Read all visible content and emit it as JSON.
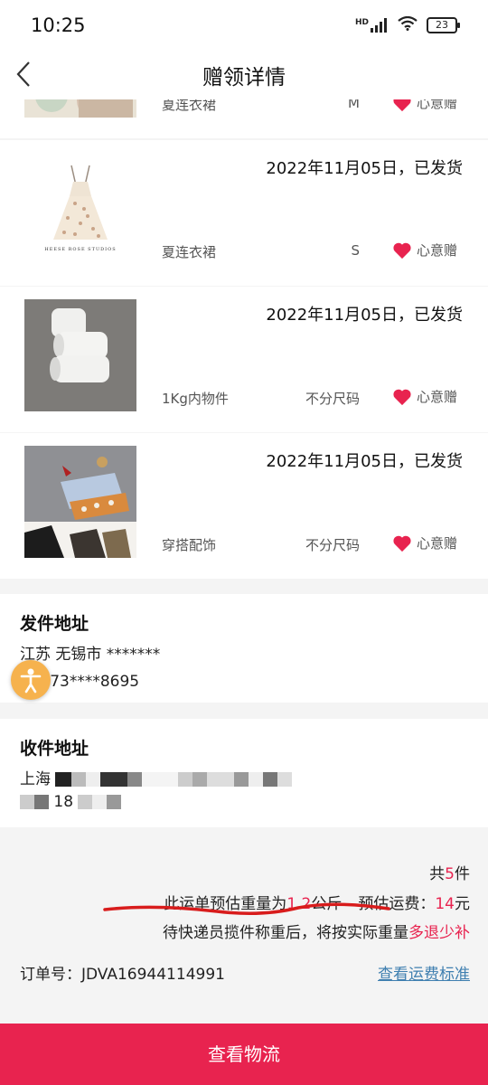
{
  "status_bar": {
    "time": "10:25",
    "network": "HD",
    "battery": "23"
  },
  "nav": {
    "title": "赠领详情"
  },
  "items": [
    {
      "name": "夏连衣裙",
      "size": "M",
      "gift_tag": "心意赠",
      "thumb": "floral-dress-photo"
    },
    {
      "date": "2022年11月05日，已发货",
      "name": "夏连衣裙",
      "size": "S",
      "gift_tag": "心意赠",
      "thumb": "dress-product-photo",
      "brand": "HEESE ROSE STUDIOS"
    },
    {
      "date": "2022年11月05日，已发货",
      "name": "1Kg内物件",
      "size": "不分尺码",
      "gift_tag": "心意赠",
      "thumb": "paper-rolls-photo"
    },
    {
      "date": "2022年11月05日，已发货",
      "name": "穿搭配饰",
      "size": "不分尺码",
      "gift_tag": "心意赠",
      "thumb": "accessories-photo"
    }
  ],
  "sender": {
    "title": "发件地址",
    "address": "江苏 无锡市 *******",
    "contact": "欧 173****8695"
  },
  "receiver": {
    "title": "收件地址",
    "address": "上海",
    "contact": "18"
  },
  "summary": {
    "count_prefix": "共",
    "count": "5",
    "count_suffix": "件",
    "weight_prefix": "此运单预估重量为",
    "weight": "1.2",
    "weight_unit": "公斤",
    "fee_label": "预估运费：",
    "fee": "14",
    "fee_unit": "元",
    "note_prefix": "待快递员揽件称重后，将按实际重量",
    "note_highlight": "多退少补",
    "order_label": "订单号：",
    "order_no": "JDVA16944114991",
    "fee_standard_link": "查看运费标准"
  },
  "bottom_button": {
    "label": "查看物流"
  },
  "colors": {
    "accent": "#e8234f",
    "link": "#3f7fb0",
    "float_button": "#f6b24e"
  }
}
